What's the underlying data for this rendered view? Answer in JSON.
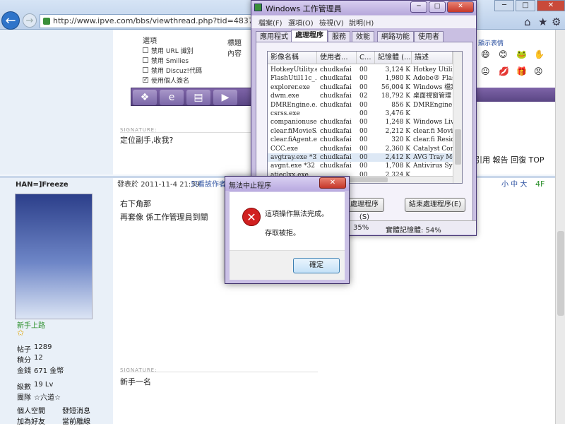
{
  "browser": {
    "url": "http://www.ipve.com/bbs/viewthread.php?tid=483771&ext",
    "back_glyph": "←",
    "forward_glyph": "→",
    "win_buttons": [
      "─",
      "□",
      "✕"
    ],
    "home_glyph": "⌂",
    "fav_glyph": "★",
    "tools_glyph": "⚙"
  },
  "post1": {
    "form_label_options": "選項",
    "form_label_title": "標題",
    "form_label_content": "內容",
    "options": [
      {
        "label": "禁用 URL 識別",
        "checked": false
      },
      {
        "label": "禁用 Smilies",
        "checked": false
      },
      {
        "label": "禁用 Discuz!代碼",
        "checked": false
      },
      {
        "label": "使用個人簽名",
        "checked": true
      }
    ],
    "signature_label": "SIGNATURE:",
    "signature_text": "定位副手,收我?",
    "actions": "引用 報告 回復 TOP"
  },
  "emoji_panel": {
    "title": "顯示表情",
    "items": [
      "😄",
      "😊",
      "🐸",
      "✋",
      "😐",
      "💋",
      "🎁",
      "😣"
    ]
  },
  "taskbar": {
    "items": [
      "❖",
      "e",
      "▤",
      "▶"
    ]
  },
  "post2": {
    "username": "HAN=]Freeze",
    "rank": "新手上路",
    "star": "✩",
    "stats": [
      {
        "label": "帖子",
        "value": "1289"
      },
      {
        "label": "積分",
        "value": "12"
      },
      {
        "label": "金錢",
        "value": "671 金幣"
      },
      {
        "label": "級數",
        "value": "19 Lv"
      },
      {
        "label": "團隊",
        "value": "☆六道☆"
      }
    ],
    "links": [
      "個人空間",
      "發短消息",
      "加為好友",
      "當前離線"
    ],
    "date": "發表於 2011-11-4 21:39",
    "author_only": "只看該作者",
    "font_size_btns": "小 中 大",
    "floor": "4F",
    "line1": "右下角那",
    "line2": "再套像 係工作管理員到關",
    "signature_label": "SIGNATURE:",
    "signature_text": "新手一名"
  },
  "taskmgr": {
    "title": "Windows 工作管理員",
    "menus": [
      "檔案(F)",
      "選項(O)",
      "檢視(V)",
      "說明(H)"
    ],
    "tabs": [
      "應用程式",
      "處理程序",
      "服務",
      "效能",
      "網路功能",
      "使用者"
    ],
    "active_tab": 1,
    "columns": [
      "影像名稱",
      "使用者...",
      "C...",
      "記憶體 (...",
      "描述"
    ],
    "processes": [
      [
        "HotkeyUtility.e...",
        "chudkafai",
        "00",
        "3,124 K",
        "Hotkey Utility"
      ],
      [
        "FlashUtil11c_...",
        "chudkafai",
        "00",
        "1,980 K",
        "Adobe® Flash"
      ],
      [
        "explorer.exe",
        "chudkafai",
        "00",
        "56,004 K",
        "Windows 檔案"
      ],
      [
        "dwm.exe",
        "chudkafai",
        "02",
        "18,792 K",
        "桌面視窗管理"
      ],
      [
        "DMREngine.e...",
        "chudkafai",
        "00",
        "856 K",
        "DMREngine"
      ],
      [
        "csrss.exe",
        "",
        "00",
        "3,476 K",
        ""
      ],
      [
        "companionuser...",
        "chudkafai",
        "00",
        "1,248 K",
        "Windows Live"
      ],
      [
        "clear.fiMovieS...",
        "chudkafai",
        "00",
        "2,212 K",
        "clear.fi Movie"
      ],
      [
        "clear.fiAgent.e...",
        "chudkafai",
        "00",
        "320 K",
        "clear.fi Resider"
      ],
      [
        "CCC.exe",
        "chudkafai",
        "00",
        "2,360 K",
        "Catalyst Contr"
      ],
      [
        "avgtray.exe *32",
        "chudkafai",
        "00",
        "2,412 K",
        "AVG Tray Mo"
      ],
      [
        "avgnt.exe *32",
        "chudkafai",
        "00",
        "1,708 K",
        "Antivirus Syste"
      ],
      [
        "atieclxx.exe",
        "",
        "00",
        "2,324 K",
        ""
      ]
    ],
    "end_process_label": "結束處理程序(E)",
    "processes_btn_label": "處理程序(S)",
    "status_cpu": "35%",
    "status_mem": "實體記憶體: 54%"
  },
  "error_dialog": {
    "title": "無法中止程序",
    "close_glyph": "✕",
    "icon_glyph": "✕",
    "message": "這項操作無法完成。",
    "sub_message": "存取被拒。",
    "ok_label": "確定"
  }
}
